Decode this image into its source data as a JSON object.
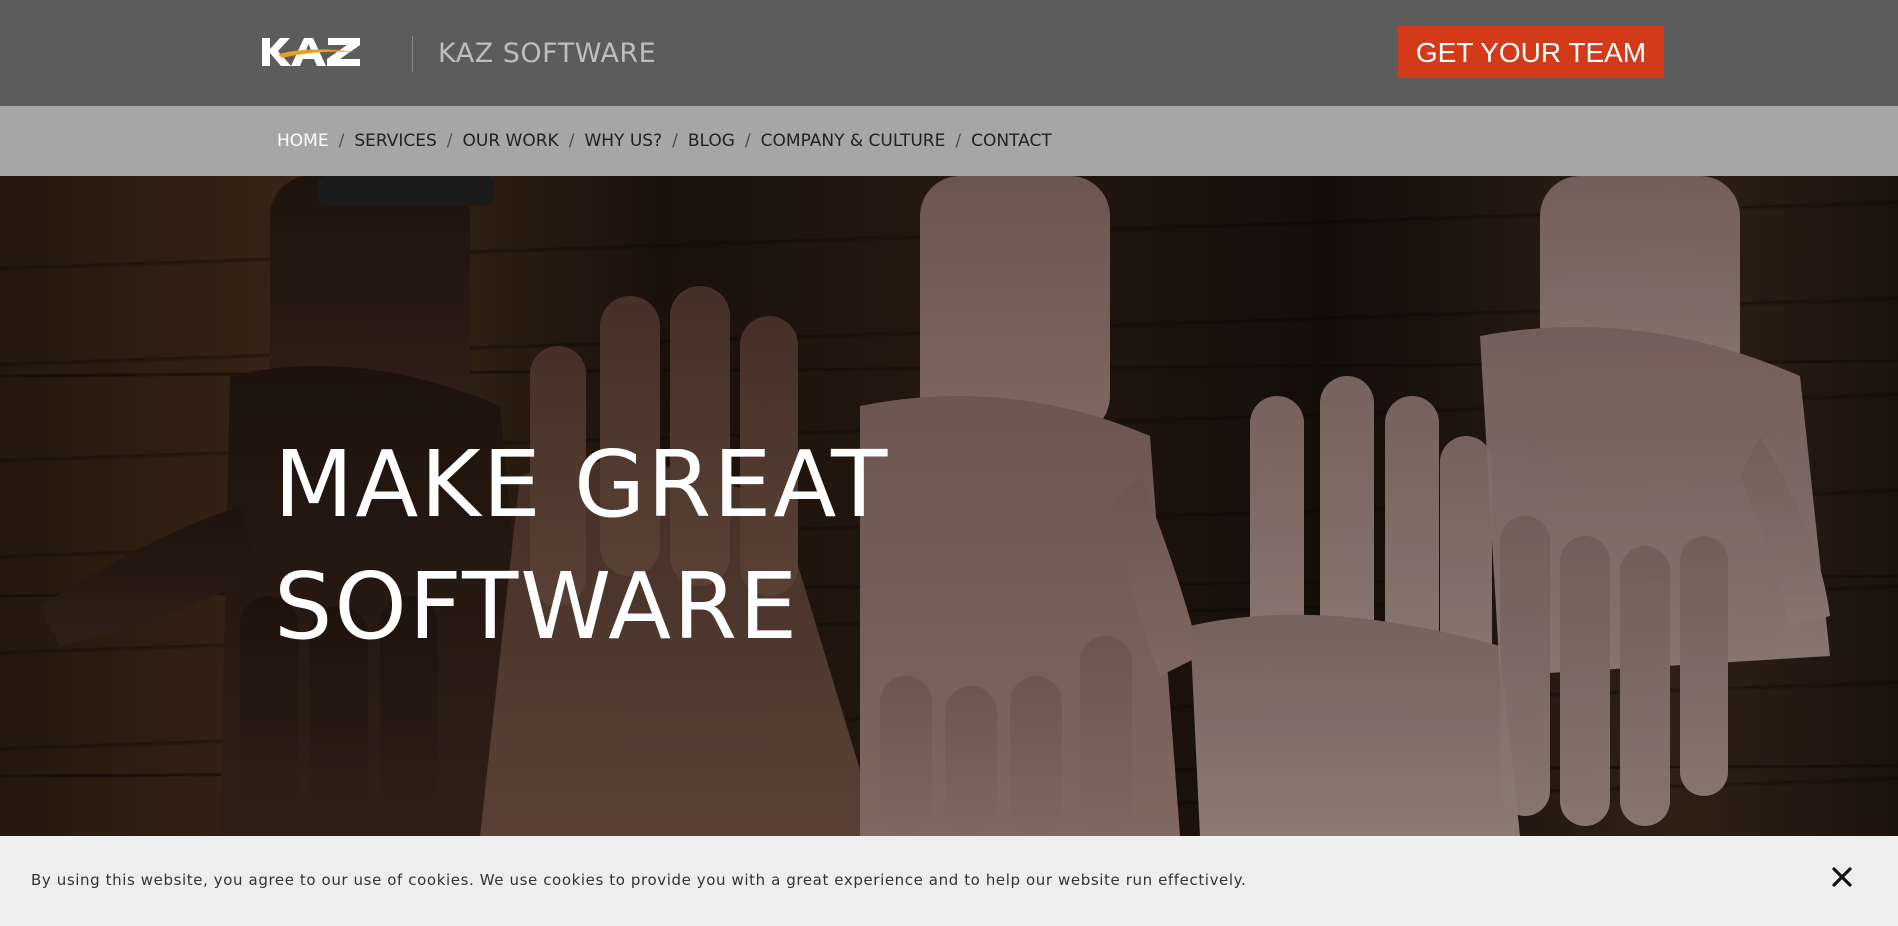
{
  "header": {
    "logo_text": "KAZ",
    "brand_name": "KAZ SOFTWARE",
    "cta_label": "GET YOUR TEAM"
  },
  "nav": {
    "items": [
      {
        "label": "HOME",
        "active": true
      },
      {
        "label": "SERVICES",
        "active": false
      },
      {
        "label": "OUR WORK",
        "active": false
      },
      {
        "label": "WHY US?",
        "active": false
      },
      {
        "label": "BLOG",
        "active": false
      },
      {
        "label": "COMPANY & CULTURE",
        "active": false
      },
      {
        "label": "CONTACT",
        "active": false
      }
    ],
    "separator": "/"
  },
  "hero": {
    "title_line1": "MAKE GREAT",
    "title_line2": "SOFTWARE"
  },
  "cookie": {
    "text": "By using this website, you agree to our use of cookies. We use cookies to provide you with a great experience and to help our website run effectively.",
    "close_icon": "close-icon"
  },
  "colors": {
    "header_bg": "#5c5c5c",
    "nav_bg": "#a6a6a6",
    "cta_bg": "#d23a1a",
    "logo_accent": "#e8a020",
    "cookie_bg": "#eeeeee"
  }
}
